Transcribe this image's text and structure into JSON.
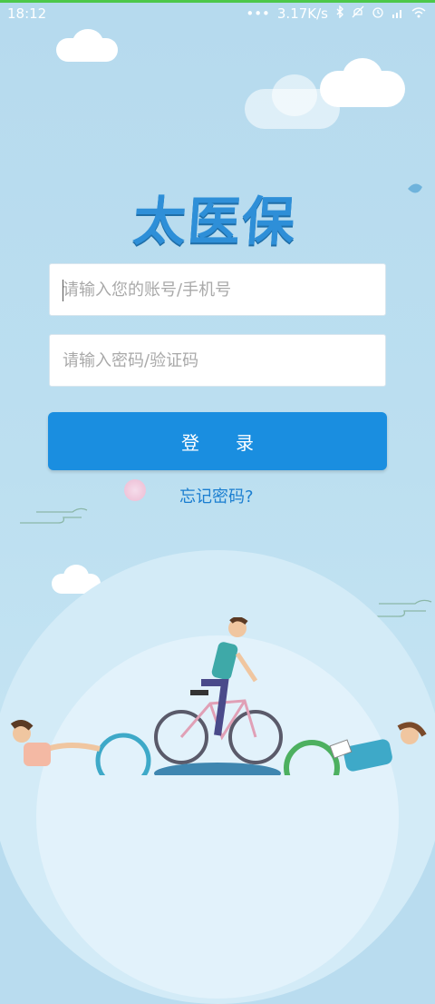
{
  "status": {
    "time": "18:12",
    "dots": "•••",
    "speed": "3.17K/s",
    "bluetooth_icon": "bluetooth-icon",
    "alarm_icon": "alarm-icon",
    "signal_icon": "signal-icon",
    "wifi_icon": "wifi-icon"
  },
  "app": {
    "logo_text": "太医保"
  },
  "form": {
    "account_placeholder": "请输入您的账号/手机号",
    "account_value": "",
    "password_placeholder": "请输入密码/验证码",
    "password_value": ""
  },
  "login_label": "登录",
  "forgot_label": "忘记密码?",
  "colors": {
    "primary": "#1a8ee0",
    "logo": "#2e8fd8",
    "background": "#b9dcef"
  }
}
